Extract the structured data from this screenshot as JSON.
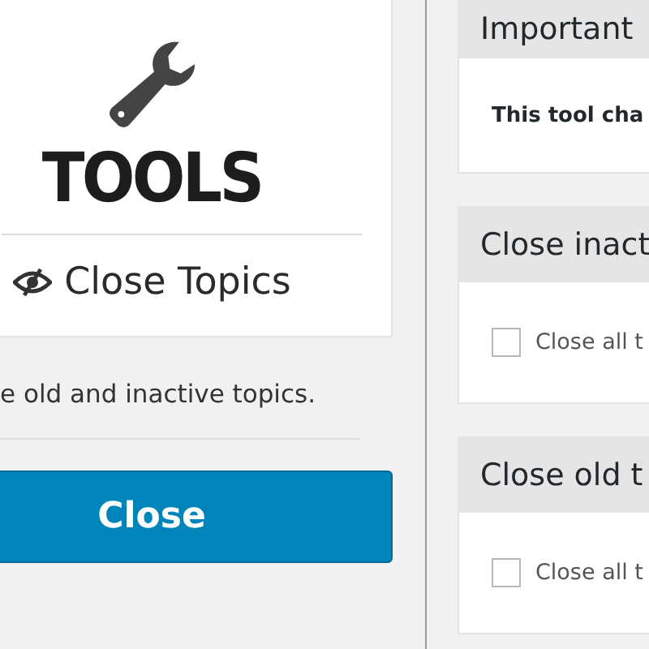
{
  "tool_card": {
    "logo_text": "TOOLS",
    "title": "Close Topics"
  },
  "description": "e old and inactive topics.",
  "close_button": {
    "label": "Close"
  },
  "panels": [
    {
      "title": "Important",
      "kind": "notice",
      "text": "This tool cha"
    },
    {
      "title": "Close inact",
      "kind": "option",
      "checked": false,
      "text": "Close all t"
    },
    {
      "title": "Close old t",
      "kind": "option",
      "checked": false,
      "text": "Close all t"
    }
  ]
}
